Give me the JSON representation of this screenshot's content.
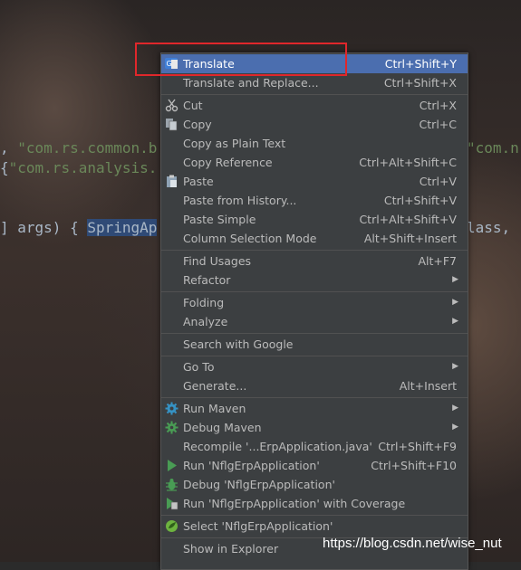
{
  "code_lines": {
    "line1_a": ", ",
    "line1_b": "\"com.rs.common.b",
    "line1_c": "\"com.n",
    "line2_a": "{",
    "line2_b": "\"com.rs.analysis.",
    "line3_a": "] args) { ",
    "line3_b": "SpringAp",
    "line3_c": "lass, "
  },
  "menu": {
    "items": [
      {
        "label": "Translate",
        "shortcut": "Ctrl+Shift+Y",
        "icon": "translate-icon"
      },
      {
        "label": "Translate and Replace...",
        "shortcut": "Ctrl+Shift+X"
      },
      {
        "label": "Cut",
        "shortcut": "Ctrl+X",
        "icon": "scissors-icon"
      },
      {
        "label": "Copy",
        "shortcut": "Ctrl+C",
        "icon": "copy-icon"
      },
      {
        "label": "Copy as Plain Text",
        "shortcut": ""
      },
      {
        "label": "Copy Reference",
        "shortcut": "Ctrl+Alt+Shift+C"
      },
      {
        "label": "Paste",
        "shortcut": "Ctrl+V",
        "icon": "paste-icon"
      },
      {
        "label": "Paste from History...",
        "shortcut": "Ctrl+Shift+V"
      },
      {
        "label": "Paste Simple",
        "shortcut": "Ctrl+Alt+Shift+V"
      },
      {
        "label": "Column Selection Mode",
        "shortcut": "Alt+Shift+Insert"
      },
      {
        "label": "Find Usages",
        "shortcut": "Alt+F7"
      },
      {
        "label": "Refactor",
        "shortcut": ""
      },
      {
        "label": "Folding",
        "shortcut": ""
      },
      {
        "label": "Analyze",
        "shortcut": ""
      },
      {
        "label": "Search with Google",
        "shortcut": ""
      },
      {
        "label": "Go To",
        "shortcut": ""
      },
      {
        "label": "Generate...",
        "shortcut": "Alt+Insert"
      },
      {
        "label": "Run Maven",
        "shortcut": "",
        "icon": "gear-icon"
      },
      {
        "label": "Debug Maven",
        "shortcut": "",
        "icon": "gear-bug-icon"
      },
      {
        "label": "Recompile '...ErpApplication.java'",
        "shortcut": "Ctrl+Shift+F9"
      },
      {
        "label": "Run 'NflgErpApplication'",
        "shortcut": "Ctrl+Shift+F10",
        "icon": "play-icon"
      },
      {
        "label": "Debug 'NflgErpApplication'",
        "shortcut": "",
        "icon": "bug-icon"
      },
      {
        "label": "Run 'NflgErpApplication' with Coverage",
        "shortcut": "",
        "icon": "coverage-icon"
      },
      {
        "label": "Select 'NflgErpApplication'",
        "shortcut": "",
        "icon": "spring-icon"
      },
      {
        "label": "Show in Explorer",
        "shortcut": ""
      }
    ]
  },
  "watermark": "https://blog.csdn.net/wise_nut",
  "colors": {
    "selected_bg": "#4b6eaf",
    "menu_bg": "#3c3f41",
    "highlight_box": "#e0272b"
  }
}
